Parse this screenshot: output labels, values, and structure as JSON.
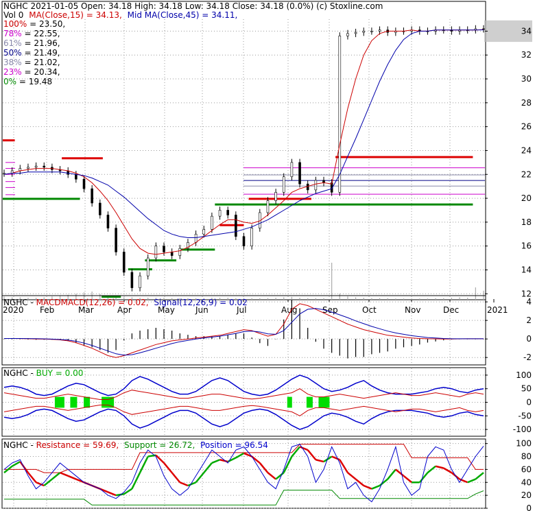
{
  "chart_data": [
    {
      "type": "candlestick",
      "symbol": "NGHC",
      "header": {
        "line1": "NGHC  2021-01-05 Open: 34.18  High: 34.18  Low: 34.18  Close: 34.18 (0.0%)  (c) Stoxline.com",
        "line2_vol": "Vol 0",
        "line2_ma15": "MA(Close,15) = 34.13,",
        "line2_ma45": "Mid MA(Close,45) = 34.11,"
      },
      "x_tick_labels": [
        "2020",
        "Feb",
        "Mar",
        "Apr",
        "May",
        "Jun",
        "Jul",
        "Aug",
        "Sep",
        "Oct",
        "Nov",
        "Dec",
        "2021"
      ],
      "y_ticks": [
        12,
        14,
        16,
        18,
        20,
        22,
        24,
        26,
        28,
        30,
        32,
        34
      ],
      "ylim": [
        11.5,
        35.0
      ],
      "grid": true,
      "fib_levels": [
        {
          "label": "100% = 23.50,",
          "value": 23.5,
          "color": "#cc0000"
        },
        {
          "label": "78% = 22.55,",
          "value": 22.55,
          "color": "#cc00cc"
        },
        {
          "label": "61% = 21.96,",
          "value": 21.96,
          "color": "#8888aa"
        },
        {
          "label": "50% = 21.49,",
          "value": 21.49,
          "color": "#000088"
        },
        {
          "label": "38% = 21.02,",
          "value": 21.02,
          "color": "#8888aa"
        },
        {
          "label": "23% = 20.34,",
          "value": 20.34,
          "color": "#cc00cc"
        },
        {
          "label": "0% = 19.48",
          "value": 19.48,
          "color": "#008800"
        }
      ],
      "close_series": [
        22.1,
        22.3,
        22.5,
        22.6,
        22.7,
        22.6,
        22.4,
        22.3,
        22.0,
        21.6,
        20.8,
        19.6,
        18.6,
        17.5,
        15.5,
        13.8,
        12.5,
        13.5,
        15.0,
        16.0,
        15.5,
        15.2,
        15.8,
        16.3,
        17.0,
        17.4,
        18.5,
        19.0,
        18.6,
        16.8,
        16.0,
        17.5,
        18.8,
        19.8,
        20.5,
        21.8,
        23.0,
        21.2,
        20.7,
        21.5,
        21.3,
        20.5,
        33.6,
        33.8,
        33.9,
        34.0,
        34.0,
        34.1,
        33.9,
        34.0,
        34.0,
        34.1,
        34.0,
        34.0,
        34.1,
        34.1,
        34.0,
        34.1,
        34.1,
        34.2,
        34.18
      ],
      "ma15_series": [
        22.0,
        22.1,
        22.3,
        22.4,
        22.5,
        22.5,
        22.5,
        22.4,
        22.3,
        22.1,
        21.8,
        21.3,
        20.6,
        19.8,
        18.8,
        17.7,
        16.6,
        15.8,
        15.4,
        15.3,
        15.4,
        15.5,
        15.6,
        15.9,
        16.3,
        16.8,
        17.3,
        17.8,
        18.2,
        18.2,
        18.0,
        17.9,
        18.1,
        18.6,
        19.2,
        19.8,
        20.5,
        20.8,
        21.0,
        21.2,
        21.3,
        21.2,
        24.5,
        27.5,
        30.0,
        32.0,
        33.2,
        33.8,
        34.0,
        34.0,
        34.0,
        34.1,
        34.0,
        34.0,
        34.1,
        34.1,
        34.1,
        34.1,
        34.1,
        34.1,
        34.13
      ],
      "ma45_series": [
        22.0,
        22.1,
        22.1,
        22.2,
        22.2,
        22.2,
        22.2,
        22.2,
        22.1,
        22.0,
        21.9,
        21.7,
        21.4,
        21.1,
        20.6,
        20.1,
        19.5,
        18.9,
        18.3,
        17.8,
        17.3,
        17.0,
        16.8,
        16.7,
        16.7,
        16.8,
        16.9,
        17.0,
        17.1,
        17.2,
        17.4,
        17.6,
        17.9,
        18.2,
        18.6,
        19.0,
        19.4,
        19.8,
        20.1,
        20.4,
        20.6,
        20.8,
        22.0,
        23.5,
        25.0,
        26.6,
        28.2,
        29.8,
        31.2,
        32.4,
        33.3,
        33.8,
        34.0,
        34.0,
        34.1,
        34.1,
        34.1,
        34.1,
        34.1,
        34.1,
        34.11
      ],
      "support_resistance_marks": [
        {
          "kind": "resistance",
          "value": 23.35,
          "from": 0.245,
          "to": 0.415
        },
        {
          "kind": "resistance",
          "value": 23.45,
          "from": 1.38,
          "to": 1.95
        },
        {
          "kind": "resistance",
          "value": 17.75,
          "from": 0.9,
          "to": 1.0
        },
        {
          "kind": "resistance",
          "value": 19.95,
          "from": 1.02,
          "to": 1.28
        },
        {
          "kind": "resistance",
          "value": 24.85,
          "from": 0.0,
          "to": 0.05
        },
        {
          "kind": "support",
          "value": 19.95,
          "from": 0.0,
          "to": 0.32
        },
        {
          "kind": "support",
          "value": 11.75,
          "from": 0.41,
          "to": 0.49
        },
        {
          "kind": "support",
          "value": 14.05,
          "from": 0.52,
          "to": 0.62
        },
        {
          "kind": "support",
          "value": 14.8,
          "from": 0.59,
          "to": 0.72
        },
        {
          "kind": "support",
          "value": 15.7,
          "from": 0.74,
          "to": 0.88
        },
        {
          "kind": "support",
          "value": 19.48,
          "from": 0.88,
          "to": 1.95
        }
      ]
    },
    {
      "type": "line",
      "title": "NGHC - MACDMACD(12,26) = 0.02,  Signal(12,26,9) = 0.02",
      "title_parts": {
        "symbol": "NGHC - ",
        "macd": "MACDMACD(12,26) = 0.02,",
        "signal": "Signal(12,26,9) = 0.02"
      },
      "y_ticks": [
        -2,
        0,
        2,
        4
      ],
      "ylim": [
        -2.8,
        4.6
      ],
      "macd_series": [
        0.05,
        0.05,
        0.04,
        0.02,
        0.0,
        -0.02,
        -0.05,
        -0.1,
        -0.2,
        -0.4,
        -0.7,
        -1.0,
        -1.4,
        -1.8,
        -2.0,
        -1.8,
        -1.5,
        -1.2,
        -0.9,
        -0.6,
        -0.4,
        -0.2,
        -0.1,
        0.0,
        0.1,
        0.2,
        0.3,
        0.4,
        0.6,
        0.8,
        1.0,
        0.9,
        0.6,
        0.3,
        0.5,
        1.6,
        3.2,
        3.8,
        3.6,
        3.2,
        2.8,
        2.4,
        2.0,
        1.6,
        1.3,
        1.0,
        0.8,
        0.6,
        0.4,
        0.3,
        0.2,
        0.1,
        0.05,
        0.02,
        0.01,
        0.0,
        0.0,
        0.01,
        0.02,
        0.02,
        0.02
      ],
      "signal_series": [
        0.05,
        0.05,
        0.05,
        0.04,
        0.03,
        0.01,
        -0.02,
        -0.06,
        -0.12,
        -0.25,
        -0.45,
        -0.7,
        -1.0,
        -1.3,
        -1.6,
        -1.75,
        -1.7,
        -1.5,
        -1.25,
        -1.0,
        -0.75,
        -0.5,
        -0.3,
        -0.15,
        0.0,
        0.1,
        0.2,
        0.3,
        0.45,
        0.6,
        0.8,
        0.85,
        0.75,
        0.55,
        0.5,
        0.9,
        1.8,
        2.7,
        3.2,
        3.3,
        3.15,
        2.9,
        2.6,
        2.3,
        1.95,
        1.65,
        1.35,
        1.1,
        0.85,
        0.65,
        0.5,
        0.35,
        0.25,
        0.15,
        0.1,
        0.05,
        0.02,
        0.02,
        0.02,
        0.02,
        0.02
      ]
    },
    {
      "type": "line",
      "title": "NGHC - BUY = 0.00",
      "title_parts": {
        "symbol": "NGHC - ",
        "buy": "BUY = 0.00"
      },
      "y_ticks": [
        -100,
        -50,
        0,
        50,
        100
      ],
      "ylim": [
        -125,
        125
      ],
      "blue_upper": [
        55,
        60,
        55,
        45,
        30,
        25,
        30,
        45,
        60,
        70,
        65,
        50,
        35,
        25,
        30,
        50,
        80,
        95,
        85,
        70,
        55,
        40,
        30,
        30,
        40,
        60,
        80,
        90,
        80,
        60,
        40,
        30,
        25,
        30,
        45,
        65,
        85,
        100,
        90,
        70,
        50,
        40,
        45,
        55,
        70,
        80,
        60,
        45,
        35,
        30,
        30,
        30,
        35,
        40,
        50,
        55,
        50,
        40,
        35,
        45,
        50
      ],
      "blue_lower": [
        -55,
        -60,
        -55,
        -45,
        -30,
        -25,
        -30,
        -45,
        -60,
        -70,
        -65,
        -50,
        -35,
        -25,
        -30,
        -50,
        -80,
        -95,
        -85,
        -70,
        -55,
        -40,
        -30,
        -30,
        -40,
        -60,
        -80,
        -90,
        -80,
        -60,
        -40,
        -30,
        -25,
        -30,
        -45,
        -65,
        -85,
        -100,
        -90,
        -70,
        -50,
        -40,
        -45,
        -55,
        -70,
        -80,
        -60,
        -45,
        -35,
        -30,
        -30,
        -30,
        -35,
        -40,
        -50,
        -55,
        -50,
        -40,
        -35,
        -45,
        -50
      ],
      "red_upper": [
        35,
        30,
        25,
        20,
        15,
        15,
        20,
        25,
        30,
        25,
        20,
        15,
        10,
        10,
        20,
        35,
        45,
        40,
        35,
        30,
        25,
        20,
        15,
        15,
        20,
        25,
        30,
        30,
        25,
        20,
        15,
        12,
        15,
        20,
        25,
        30,
        35,
        50,
        30,
        20,
        20,
        25,
        30,
        25,
        20,
        15,
        20,
        25,
        30,
        35,
        30,
        25,
        25,
        30,
        35,
        30,
        25,
        20,
        30,
        35,
        30
      ],
      "red_lower": [
        -35,
        -30,
        -25,
        -20,
        -15,
        -15,
        -20,
        -25,
        -30,
        -25,
        -20,
        -15,
        -10,
        -10,
        -20,
        -35,
        -45,
        -40,
        -35,
        -30,
        -25,
        -20,
        -15,
        -15,
        -20,
        -25,
        -30,
        -30,
        -25,
        -20,
        -15,
        -12,
        -15,
        -20,
        -25,
        -30,
        -35,
        -50,
        -30,
        -20,
        -20,
        -25,
        -30,
        -25,
        -20,
        -15,
        -20,
        -25,
        -30,
        -35,
        -30,
        -25,
        -25,
        -30,
        -35,
        -30,
        -25,
        -20,
        -30,
        -35,
        -30
      ],
      "buy_signals_x": [
        0.108,
        0.14,
        0.168,
        0.205,
        0.59,
        0.63,
        0.655
      ],
      "buy_signal_widths": [
        1,
        0.6,
        0.5,
        1.4,
        0.3,
        0.5,
        1.2
      ]
    },
    {
      "type": "line",
      "title": "NGHC - Resistance = 59.69,  Support = 26.72,  Position = 96.54",
      "title_parts": {
        "symbol": "NGHC - ",
        "resistance": "Resistance = 59.69,",
        "support": "Support = 26.72,",
        "position": "Position = 96.54"
      },
      "y_ticks": [
        0,
        20,
        40,
        60,
        80,
        100
      ],
      "ylim": [
        0,
        106
      ],
      "resistance_series": [
        60,
        60,
        60,
        60,
        60,
        55,
        55,
        55,
        60,
        60,
        60,
        60,
        60,
        60,
        60,
        60,
        60,
        86,
        86,
        86,
        86,
        86,
        86,
        86,
        86,
        86,
        86,
        86,
        86,
        86,
        86,
        86,
        86,
        86,
        86,
        86,
        86,
        99,
        99,
        99,
        99,
        99,
        99,
        99,
        99,
        99,
        99,
        99,
        99,
        99,
        99,
        78,
        78,
        78,
        78,
        78,
        78,
        78,
        78,
        60,
        60
      ],
      "support_series": [
        14,
        14,
        14,
        14,
        14,
        14,
        14,
        14,
        14,
        14,
        14,
        5,
        5,
        5,
        5,
        5,
        5,
        5,
        5,
        5,
        5,
        5,
        5,
        5,
        5,
        5,
        5,
        5,
        5,
        5,
        5,
        5,
        5,
        5,
        5,
        28,
        28,
        28,
        28,
        28,
        28,
        28,
        15,
        15,
        15,
        15,
        15,
        15,
        15,
        15,
        15,
        15,
        15,
        15,
        15,
        15,
        15,
        15,
        15,
        22,
        27
      ],
      "blue_series": [
        60,
        70,
        75,
        50,
        30,
        40,
        55,
        70,
        60,
        50,
        40,
        35,
        30,
        20,
        15,
        25,
        40,
        70,
        90,
        80,
        50,
        30,
        20,
        30,
        50,
        70,
        90,
        80,
        70,
        90,
        95,
        80,
        60,
        40,
        30,
        60,
        95,
        99,
        80,
        40,
        60,
        95,
        70,
        30,
        40,
        20,
        10,
        30,
        60,
        95,
        40,
        20,
        30,
        80,
        95,
        90,
        60,
        40,
        60,
        80,
        96
      ],
      "position_series": [
        55,
        65,
        72,
        55,
        40,
        35,
        45,
        55,
        50,
        45,
        40,
        35,
        30,
        25,
        20,
        22,
        30,
        55,
        80,
        82,
        70,
        55,
        40,
        35,
        40,
        55,
        70,
        75,
        72,
        78,
        85,
        80,
        70,
        55,
        45,
        55,
        80,
        95,
        90,
        75,
        72,
        80,
        75,
        55,
        45,
        35,
        30,
        35,
        45,
        60,
        50,
        40,
        40,
        55,
        65,
        62,
        55,
        45,
        40,
        45,
        55
      ]
    }
  ]
}
